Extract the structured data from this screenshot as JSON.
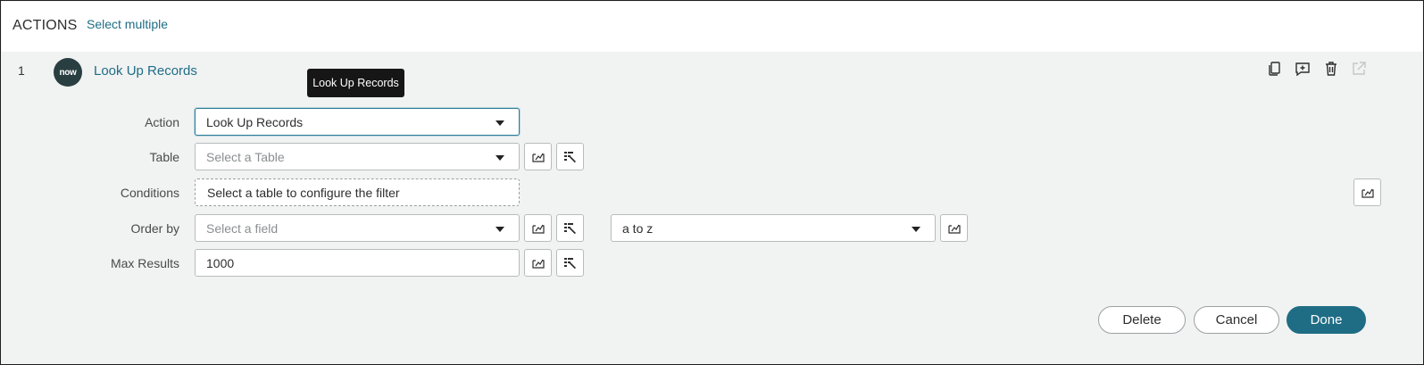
{
  "header": {
    "title": "ACTIONS",
    "select_multiple": "Select multiple"
  },
  "step": {
    "number": "1",
    "logo_text": "now",
    "title": "Look Up Records",
    "tooltip": "Look Up Records"
  },
  "step_toolbar": {
    "icons": [
      "copy-icon",
      "add-comment-icon",
      "trash-icon",
      "open-external-icon"
    ]
  },
  "form": {
    "action": {
      "label": "Action",
      "value": "Look Up Records"
    },
    "table": {
      "label": "Table",
      "placeholder": "Select a Table"
    },
    "conditions": {
      "label": "Conditions",
      "value": "Select a table to configure the filter"
    },
    "order_by": {
      "label": "Order by",
      "placeholder": "Select a field",
      "direction": "a to z"
    },
    "max_results": {
      "label": "Max Results",
      "value": "1000"
    }
  },
  "buttons": {
    "delete": "Delete",
    "cancel": "Cancel",
    "done": "Done"
  },
  "colors": {
    "accent": "#1f6d85",
    "tooltip_bg": "#161616",
    "panel_bg": "#f1f2f2"
  }
}
